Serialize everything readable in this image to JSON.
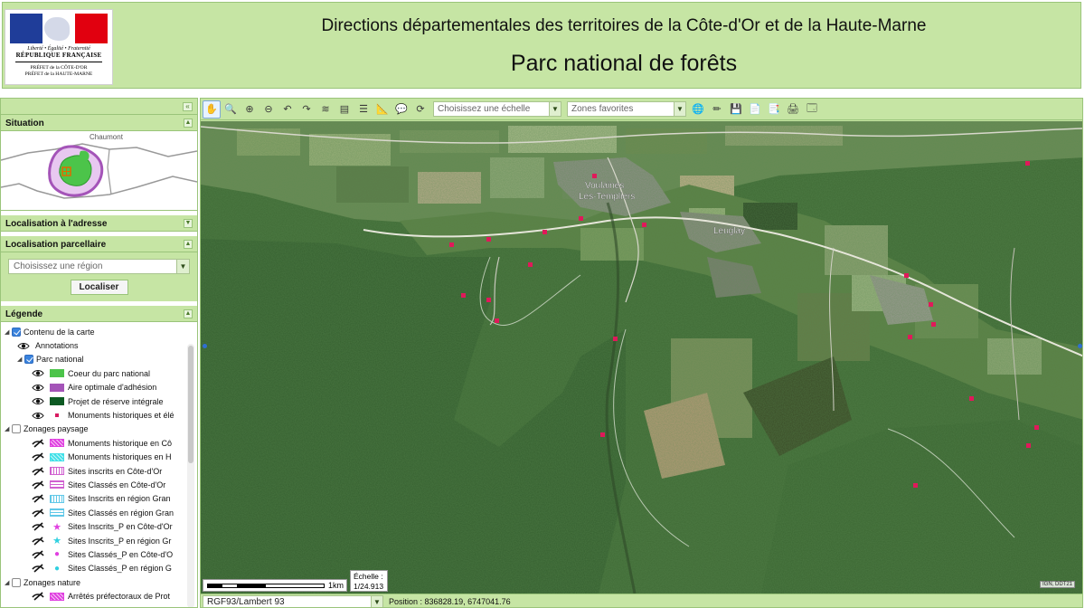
{
  "header": {
    "logo": {
      "motto": "Liberté • Égalité • Fraternité",
      "republique": "RÉPUBLIQUE FRANÇAISE",
      "prefet1": "PRÉFET de la CÔTE-D'OR",
      "prefet2": "PRÉFET de la HAUTE-MARNE"
    },
    "title": "Directions départementales des territoires de la Côte-d'Or et de la Haute-Marne",
    "subtitle": "Parc national de forêts"
  },
  "left_panel": {
    "situation": {
      "title": "Situation",
      "map_label": "Chaumont"
    },
    "localisation_adresse": {
      "title": "Localisation à l'adresse"
    },
    "localisation_parcellaire": {
      "title": "Localisation parcellaire",
      "region_placeholder": "Choisissez une région",
      "button": "Localiser"
    },
    "legende": {
      "title": "Légende",
      "items": [
        {
          "label": "Contenu de la carte",
          "level": 0,
          "checked": true,
          "icon": "checkbox"
        },
        {
          "label": "Annotations",
          "level": 1,
          "icon": "eye-icon"
        },
        {
          "label": "Parc national",
          "level": 1,
          "checked": true,
          "icon": "checkbox"
        },
        {
          "label": "Coeur du parc national",
          "level": 2,
          "icon": "eye-icon",
          "swatch": "#4cc44a"
        },
        {
          "label": "Aire optimale d'adhésion",
          "level": 2,
          "icon": "eye-icon",
          "swatch": "#a454b8"
        },
        {
          "label": "Projet de réserve intégrale",
          "level": 2,
          "icon": "eye-icon",
          "swatch": "#0d5a23"
        },
        {
          "label": "Monuments historiques et élé",
          "level": 2,
          "icon": "eye-icon",
          "dot": "#d81b60"
        },
        {
          "label": "Zonages paysage",
          "level": 0,
          "checked": false,
          "icon": "checkbox"
        },
        {
          "label": "Monuments historique en Cô",
          "level": 2,
          "icon": "hidden-eye-icon",
          "swatch": "#e040e0",
          "style": "hatch"
        },
        {
          "label": "Monuments historiques en H",
          "level": 2,
          "icon": "hidden-eye-icon",
          "swatch": "#40e0e8",
          "style": "hatch"
        },
        {
          "label": "Sites inscrits en Côte-d'Or",
          "level": 2,
          "icon": "hidden-eye-icon",
          "swatch": "#d060d0",
          "style": "vlines"
        },
        {
          "label": "Sites Classés en Côte-d'Or",
          "level": 2,
          "icon": "hidden-eye-icon",
          "swatch": "#d060d0",
          "style": "hlines"
        },
        {
          "label": "Sites Inscrits en région Gran",
          "level": 2,
          "icon": "hidden-eye-icon",
          "swatch": "#60c8e8",
          "style": "vlines"
        },
        {
          "label": "Sites Classés en région Gran",
          "level": 2,
          "icon": "hidden-eye-icon",
          "swatch": "#60c8e8",
          "style": "hlines"
        },
        {
          "label": "Sites Inscrits_P en Côte-d'Or",
          "level": 2,
          "icon": "hidden-eye-icon",
          "marker": "★",
          "marker_color": "#e040e0"
        },
        {
          "label": "Sites Inscrits_P en région Gr",
          "level": 2,
          "icon": "hidden-eye-icon",
          "marker": "★",
          "marker_color": "#30d0e0"
        },
        {
          "label": "Sites Classés_P en Côte-d'O",
          "level": 2,
          "icon": "hidden-eye-icon",
          "marker": "●",
          "marker_color": "#e040e0"
        },
        {
          "label": "Sites Classés_P en région G",
          "level": 2,
          "icon": "hidden-eye-icon",
          "marker": "●",
          "marker_color": "#30d0e0"
        },
        {
          "label": "Zonages nature",
          "level": 0,
          "checked": false,
          "icon": "checkbox"
        },
        {
          "label": "Arrêtés préfectoraux de Prot",
          "level": 2,
          "icon": "hidden-eye-icon",
          "swatch": "#e040e0",
          "style": "hatch"
        }
      ]
    }
  },
  "toolbar": {
    "scale_placeholder": "Choisissez une échelle",
    "favorites_placeholder": "Zones favorites"
  },
  "map": {
    "labels": {
      "village1_line1": "Voulaines",
      "village1_line2": "Les-Templiers",
      "village2": "Leuglay"
    },
    "scalebar_label": "1km",
    "echelle_label": "Échelle :",
    "echelle_value": "1/24.913",
    "attribution": "IGN, DDT21",
    "monument_color": "#e0195a"
  },
  "statusbar": {
    "crs": "RGF93/Lambert 93",
    "position_label": "Position :",
    "position_value": "836828.19, 6747041.76"
  }
}
